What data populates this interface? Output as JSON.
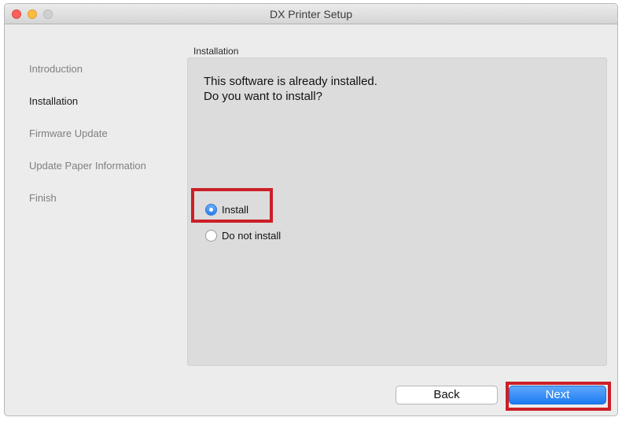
{
  "window": {
    "title": "DX Printer Setup"
  },
  "sidebar": {
    "items": [
      {
        "label": "Introduction",
        "active": false
      },
      {
        "label": "Installation",
        "active": true
      },
      {
        "label": "Firmware Update",
        "active": false
      },
      {
        "label": "Update Paper Information",
        "active": false
      },
      {
        "label": "Finish",
        "active": false
      }
    ]
  },
  "main": {
    "section_label": "Installation",
    "message_line1": "This software is already installed.",
    "message_line2": "Do you want to install?",
    "options": [
      {
        "label": "Install",
        "selected": true
      },
      {
        "label": "Do not install",
        "selected": false
      }
    ]
  },
  "buttons": {
    "back_label": "Back",
    "next_label": "Next"
  },
  "colors": {
    "accent_blue": "#2a7ff0",
    "highlight_red": "#cc1f26"
  }
}
